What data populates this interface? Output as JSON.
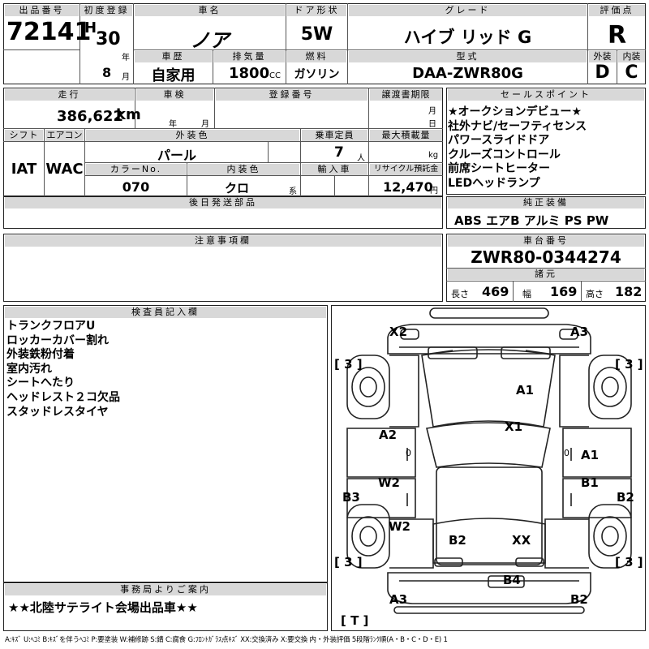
{
  "header": {
    "lot_label": "出品番号",
    "lot_number": "72141",
    "first_reg_label": "初度登録",
    "era": "H",
    "year": "30",
    "year_unit": "年",
    "month": "8",
    "month_unit": "月",
    "name_label": "車名",
    "car_name": "ノア",
    "doors_label": "ドア形状",
    "doors": "5W",
    "grade_label": "グレード",
    "grade": "ハイブ リッド G",
    "score_label": "評価点",
    "score": "R",
    "history_label": "車歴",
    "history": "自家用",
    "displacement_label": "排気量",
    "displacement": "1800",
    "displacement_unit": "CC",
    "fuel_label": "燃料",
    "fuel": "ガソリン",
    "model_label": "型式",
    "model": "DAA-ZWR80G",
    "exterior_label": "外装",
    "exterior_grade": "D",
    "interior_label": "内装",
    "interior_grade": "C"
  },
  "row2": {
    "mileage_label": "走行",
    "mileage": "386,622",
    "mileage_unit": "km",
    "inspection_label": "車検",
    "inspection_year_unit": "年",
    "inspection_month_unit": "月",
    "registration_label": "登録番号",
    "transfer_label": "譲渡書期限",
    "transfer_month_unit": "月",
    "transfer_day_unit": "日",
    "shift_label": "シフト",
    "shift": "IAT",
    "aircon_label": "エアコン",
    "aircon": "WAC",
    "ext_color_label": "外装色",
    "ext_color": "パール",
    "capacity_label": "乗車定員",
    "capacity": "7",
    "capacity_unit": "人",
    "max_load_label": "最大積載量",
    "max_load_unit": "kg",
    "color_no_label": "カラーNo.",
    "color_no": "070",
    "int_color_label": "内装色",
    "int_color": "クロ",
    "int_color_unit": "系",
    "import_label": "輸入車",
    "recycle_label": "リサイクル預託金",
    "recycle": "12,470",
    "recycle_unit": "円",
    "later_parts_label": "後日発送部品"
  },
  "sales_points": {
    "label": "セールスポイント",
    "items": [
      "★オークションデビュー★",
      "社外ナビ/セーフティセンス",
      "パワースライドドア",
      "クルーズコントロール",
      "前席シートヒーター",
      "LEDヘッドランプ"
    ]
  },
  "equipment": {
    "label": "純正装備",
    "value": "ABS エアB アルミ PS PW"
  },
  "notes": {
    "label": "注意事項欄"
  },
  "chassis": {
    "label": "車台番号",
    "value": "ZWR80-0344274",
    "spec_label": "諸元",
    "length_label": "長さ",
    "length": "469",
    "width_label": "幅",
    "width": "169",
    "height_label": "高さ",
    "height": "182"
  },
  "inspector": {
    "label": "検査員記入欄",
    "items": [
      "トランクフロアU",
      "ロッカーカバー割れ",
      "外装鉄粉付着",
      "室内汚れ",
      "シートへたり",
      "ヘッドレスト２コ欠品",
      "スタッドレスタイヤ"
    ]
  },
  "office": {
    "label": "事務局よりご案内",
    "message": "★★北陸サテライト会場出品車★★"
  },
  "diagram": {
    "marks": {
      "x2": "X2",
      "a3_top": "A3",
      "a1_hood": "A1",
      "x1": "X1",
      "a2_left": "A2",
      "a1_right": "A1",
      "w2_left": "W2",
      "b1": "B1",
      "b3_left": "B3",
      "b2_right": "B2",
      "w2_left2": "W2",
      "b2_center": "B2",
      "xx": "XX",
      "b4": "B4",
      "a3_bottom": "A3",
      "b2_bottom": "B2"
    },
    "tires": {
      "fl": "[ 3 ]",
      "fr": "[ 3 ]",
      "rl": "[ 3 ]",
      "rr": "[ 3 ]",
      "spare": "[ T ]"
    },
    "zero": "0"
  },
  "legend": "A:ｷｽﾞ  U:ﾍｺﾐ  B:ｷｽﾞを伴うﾍｺﾐ  P:要塗装  W:補修跡  S:錆  C:腐食  G:ﾌﾛﾝﾄｶﾞﾗｽ点ｷｽﾞ  XX:交換済み  X:要交換  内・外装評価  5段階ﾗﾝｸ順(A・B・C・D・E)  1"
}
